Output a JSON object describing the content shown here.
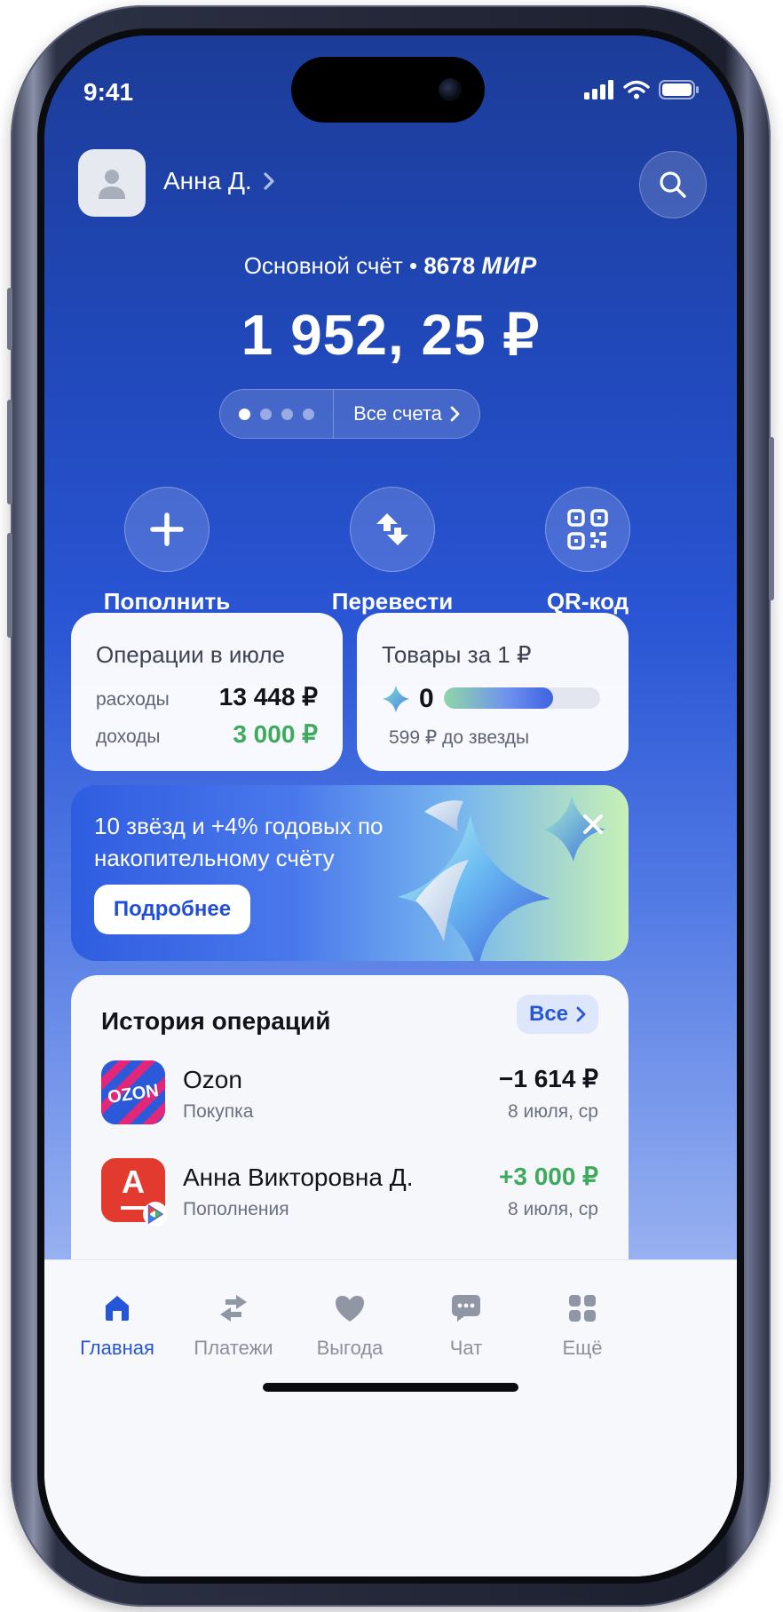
{
  "status_bar": {
    "time": "9:41"
  },
  "header": {
    "user_name": "Анна Д.",
    "avatar_icon": "user-icon",
    "search_icon": "search-icon"
  },
  "account": {
    "label": "Основной счёт",
    "separator": "•",
    "card_last_digits": "8678",
    "payment_system": "МИР",
    "balance": "1 952, 25 ₽",
    "all_accounts_label": "Все счета",
    "pager_total": 4,
    "pager_active": 1
  },
  "actions": [
    {
      "label": "Пополнить",
      "icon": "plus-icon"
    },
    {
      "label": "Перевести",
      "icon": "transfer-arrows-icon"
    },
    {
      "label": "QR-код",
      "icon": "qr-code-icon"
    }
  ],
  "operations_card": {
    "title": "Операции в июле",
    "expenses_label": "расходы",
    "expenses_value": "13 448 ₽",
    "income_label": "доходы",
    "income_value": "3 000 ₽"
  },
  "goods_card": {
    "title": "Товары за 1 ₽",
    "stars_count": "0",
    "progress_fraction": 0.7,
    "subtitle": "599 ₽ до звезды"
  },
  "promo": {
    "text": "10 звёзд и +4% годовых по накопительному счёту",
    "button_label": "Подробнее",
    "close_icon": "close-icon"
  },
  "history": {
    "title": "История операций",
    "all_label": "Все",
    "transactions": [
      {
        "title": "Ozon",
        "subtitle": "Покупка",
        "amount": "−1 614 ₽",
        "date": "8 июля, ср",
        "logo_text": "OZON"
      },
      {
        "title": "Анна Викторовна Д.",
        "subtitle": "Пополнения",
        "amount": "+3 000 ₽",
        "date": "8 июля, ср",
        "logo_text": "А"
      }
    ]
  },
  "tabbar": {
    "tabs": [
      {
        "label": "Главная",
        "icon": "home-icon",
        "active": true
      },
      {
        "label": "Платежи",
        "icon": "payments-arrows-icon",
        "active": false
      },
      {
        "label": "Выгода",
        "icon": "heart-icon",
        "active": false
      },
      {
        "label": "Чат",
        "icon": "chat-icon",
        "active": false
      },
      {
        "label": "Ещё",
        "icon": "grid-icon",
        "active": false
      }
    ]
  },
  "colors": {
    "accent": "#2655d8",
    "positive": "#3eaa5c",
    "background_top": "#1c3c98",
    "background_bottom": "#d5dff8"
  }
}
